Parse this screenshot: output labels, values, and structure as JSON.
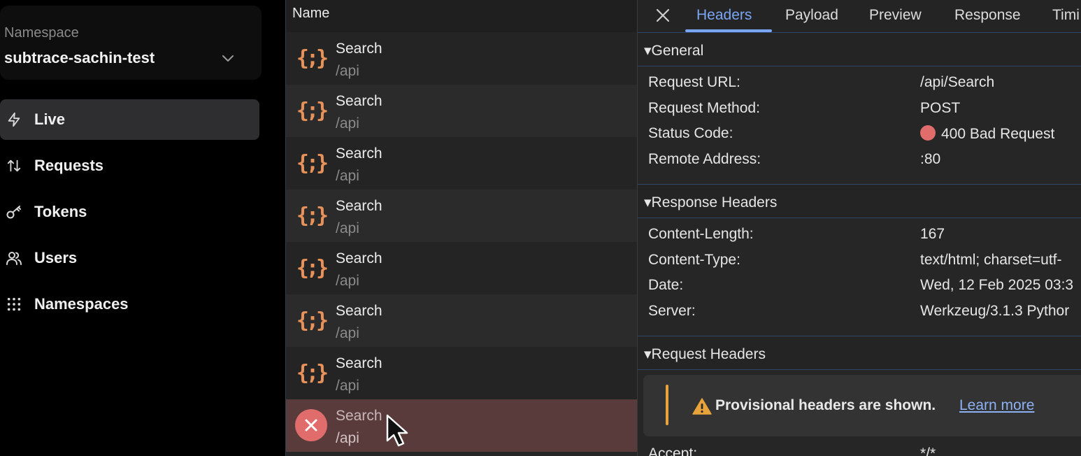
{
  "sidebar": {
    "namespace_label": "Namespace",
    "namespace_value": "subtrace-sachin-test",
    "items": [
      {
        "label": "Live",
        "icon": "lightning-icon",
        "active": true
      },
      {
        "label": "Requests",
        "icon": "sort-arrows-icon",
        "active": false
      },
      {
        "label": "Tokens",
        "icon": "key-icon",
        "active": false
      },
      {
        "label": "Users",
        "icon": "users-icon",
        "active": false
      },
      {
        "label": "Namespaces",
        "icon": "grid-dots-icon",
        "active": false
      }
    ]
  },
  "list": {
    "header": "Name",
    "rows": [
      {
        "name": "Search",
        "path": "/api",
        "status": "ok"
      },
      {
        "name": "Search",
        "path": "/api",
        "status": "ok"
      },
      {
        "name": "Search",
        "path": "/api",
        "status": "ok"
      },
      {
        "name": "Search",
        "path": "/api",
        "status": "ok"
      },
      {
        "name": "Search",
        "path": "/api",
        "status": "ok"
      },
      {
        "name": "Search",
        "path": "/api",
        "status": "ok"
      },
      {
        "name": "Search",
        "path": "/api",
        "status": "ok"
      },
      {
        "name": "Search",
        "path": "/api",
        "status": "error"
      }
    ]
  },
  "detail": {
    "tabs": [
      "Headers",
      "Payload",
      "Preview",
      "Response",
      "Timi"
    ],
    "active_tab": "Headers",
    "general": {
      "title": "▾General",
      "rows": [
        {
          "key": "Request URL:",
          "value": "/api/Search"
        },
        {
          "key": "Request Method:",
          "value": "POST"
        },
        {
          "key": "Status Code:",
          "value": "400 Bad Request"
        },
        {
          "key": "Remote Address:",
          "value": ":80"
        }
      ]
    },
    "response_headers": {
      "title": "▾Response Headers",
      "rows": [
        {
          "key": "Content-Length:",
          "value": "167"
        },
        {
          "key": "Content-Type:",
          "value": "text/html; charset=utf-"
        },
        {
          "key": "Date:",
          "value": "Wed, 12 Feb 2025 03:3"
        },
        {
          "key": "Server:",
          "value": "Werkzeug/3.1.3 Pythor"
        }
      ]
    },
    "request_headers": {
      "title": "▾Request Headers",
      "warning": "Provisional headers are shown.",
      "learn_more": "Learn more",
      "rows": [
        {
          "key": "Accept:",
          "value": "*/*"
        }
      ]
    }
  },
  "colors": {
    "accent": "#7aa6f4",
    "error": "#e06c6c",
    "icon_orange": "#e8925a",
    "warning": "#e8a33a"
  }
}
